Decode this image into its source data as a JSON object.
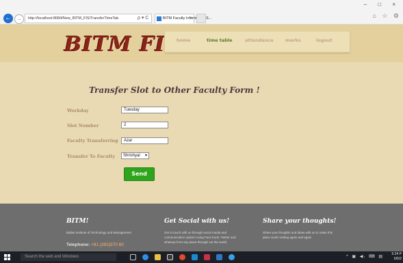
{
  "browser": {
    "address": "http://localhost:8084/New_BITM_FIS/TransferTimeTab",
    "address_host": "localhost",
    "tab_title": "BITM Faculty Information S...",
    "tab_close": "×",
    "back_glyph": "←",
    "forward_glyph": "→",
    "address_buttons": "ρ ▾ C",
    "window_controls": "– □ ×",
    "right_icons": "⌂ ☆ ⚙"
  },
  "site": {
    "logo": "BITM FIS",
    "nav": [
      {
        "label": "home",
        "active": false
      },
      {
        "label": "time table",
        "active": true
      },
      {
        "label": "attendance",
        "active": false
      },
      {
        "label": "marks",
        "active": false
      },
      {
        "label": "logout",
        "active": false
      }
    ]
  },
  "form": {
    "title": "Transfer Slot to Other Faculty Form !",
    "fields": [
      {
        "label": "Workday",
        "value": "Tuesday"
      },
      {
        "label": "Slot Number",
        "value": "2"
      },
      {
        "label": "Faculty Transferring",
        "value": "Azar"
      },
      {
        "label": "Transfer To Faculty",
        "value": "Shrishyal"
      }
    ],
    "select_caret": "▾",
    "submit_label": "Send"
  },
  "footer": {
    "col1": {
      "heading": "BITM!",
      "text": "Ballari Institute of Technology and Management",
      "tel_label": "Telephone:",
      "tel_value": "+91 (392)570 80"
    },
    "col2": {
      "heading": "Get Social with us!",
      "text": "Get in touch with us through social media and communication system using Face book, Twitter and whatsup from any place through out the world."
    },
    "col3": {
      "heading": "Share your thoughts!",
      "text": "Share your thoughts and ideas with us to make this place worth visiting again and again"
    }
  },
  "taskbar": {
    "search_placeholder": "Search the web and Windows",
    "tray": "^ ▣ ◀ᵢ ⌨ ▤",
    "time": "5:24 P",
    "date": "6/5/2"
  },
  "colors": {
    "page_bg": "#e9dab3",
    "logo": "#8a2418",
    "active_nav": "#5d7a2c",
    "send_button": "#2fa51d",
    "footer_bg": "#6e6e6e"
  }
}
